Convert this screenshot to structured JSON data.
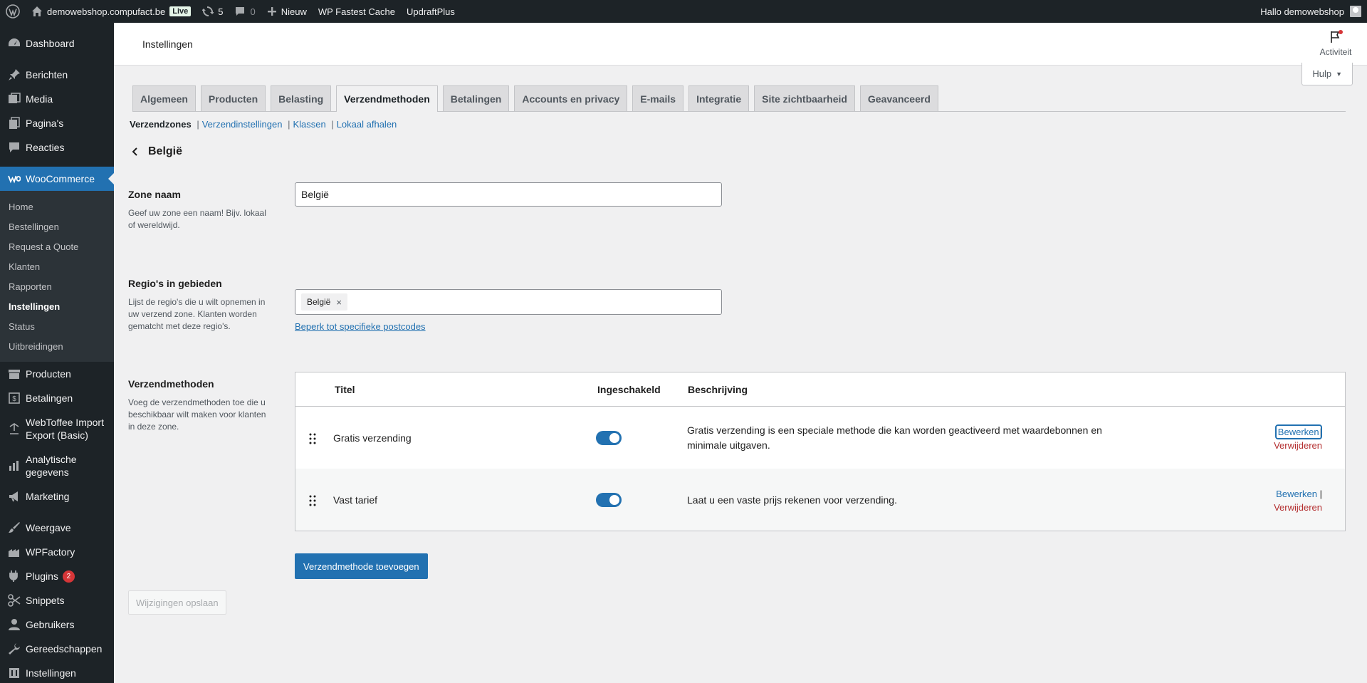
{
  "adminbar": {
    "site_name": "demowebshop.compufact.be",
    "live_badge": "Live",
    "updates_count": "5",
    "comments_count": "0",
    "new_label": "Nieuw",
    "plugin1": "WP Fastest Cache",
    "plugin2": "UpdraftPlus",
    "greeting": "Hallo demowebshop"
  },
  "sidebar": {
    "dashboard": "Dashboard",
    "berichten": "Berichten",
    "media": "Media",
    "paginas": "Pagina's",
    "reacties": "Reacties",
    "woocommerce": "WooCommerce",
    "woo_sub": [
      "Home",
      "Bestellingen",
      "Request a Quote",
      "Klanten",
      "Rapporten",
      "Instellingen",
      "Status",
      "Uitbreidingen"
    ],
    "producten": "Producten",
    "betalingen": "Betalingen",
    "webtoffee_line1": "WebToffee Import",
    "webtoffee_line2": "Export (Basic)",
    "analytics_line1": "Analytische",
    "analytics_line2": "gegevens",
    "marketing": "Marketing",
    "weergave": "Weergave",
    "wpfactory": "WPFactory",
    "plugins": "Plugins",
    "plugins_badge": "2",
    "snippets": "Snippets",
    "gebruikers": "Gebruikers",
    "gereedschappen": "Gereedschappen",
    "instellingen": "Instellingen"
  },
  "header": {
    "title": "Instellingen",
    "activity_label": "Activiteit",
    "help_label": "Hulp"
  },
  "tabs": [
    "Algemeen",
    "Producten",
    "Belasting",
    "Verzendmethoden",
    "Betalingen",
    "Accounts en privacy",
    "E-mails",
    "Integratie",
    "Site zichtbaarheid",
    "Geavanceerd"
  ],
  "subnav": {
    "current": "Verzendzones",
    "links": [
      "Verzendinstellingen",
      "Klassen",
      "Lokaal afhalen"
    ]
  },
  "zone": {
    "title": "België",
    "name_label": "Zone naam",
    "name_desc": "Geef uw zone een naam! Bijv. lokaal of wereldwijd.",
    "name_value": "België",
    "regions_label": "Regio's in gebieden",
    "regions_desc": "Lijst de regio's die u wilt opnemen in uw verzend zone. Klanten worden gematcht met deze regio's.",
    "region_chip": "België",
    "region_remove": "×",
    "limit_link": "Beperk tot specifieke postcodes"
  },
  "methods": {
    "label": "Verzendmethoden",
    "desc": "Voeg de verzendmethoden toe die u beschikbaar wilt maken voor klanten in deze zone.",
    "col_title": "Titel",
    "col_enabled": "Ingeschakeld",
    "col_desc": "Beschrijving",
    "rows": [
      {
        "title": "Gratis verzending",
        "description": "Gratis verzending is een speciale methode die kan worden geactiveerd met waardebonnen en minimale uitgaven.",
        "edit": "Bewerken",
        "delete": "Verwijderen"
      },
      {
        "title": "Vast tarief",
        "description": "Laat u een vaste prijs rekenen voor verzending.",
        "edit": "Bewerken",
        "delete": "Verwijderen"
      }
    ],
    "add_button": "Verzendmethode toevoegen",
    "pipe": "|"
  },
  "save_button": "Wijzigingen opslaan",
  "colors": {
    "accent": "#2271b1",
    "admin_dark": "#1d2327",
    "danger": "#b32d2e"
  }
}
